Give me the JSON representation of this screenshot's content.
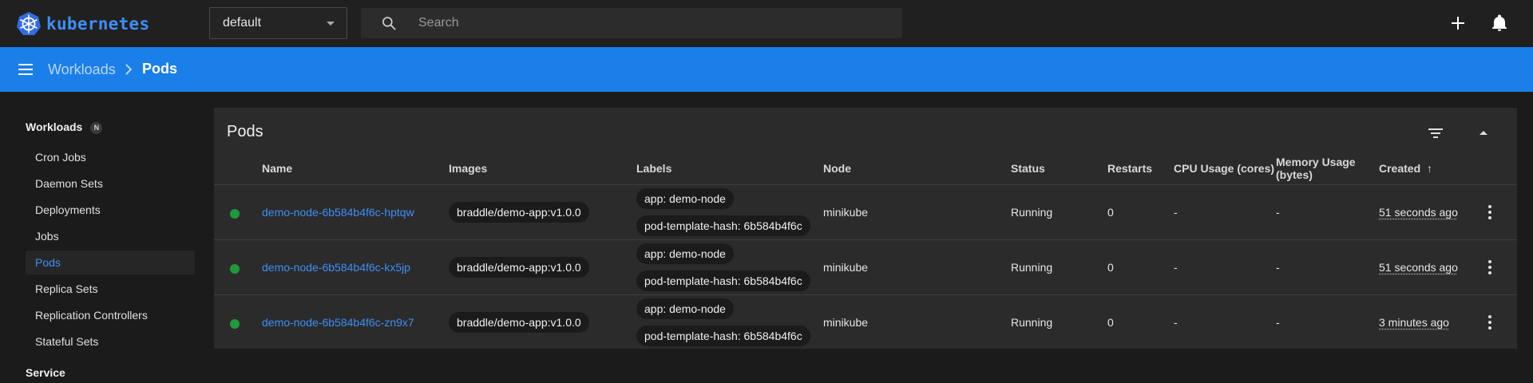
{
  "app": {
    "name": "kubernetes",
    "brand_color": "#326ce5",
    "accent_color": "#1a7fe8",
    "link_color": "#3d8ff5"
  },
  "topbar": {
    "namespace": "default",
    "search_placeholder": "Search",
    "icons": [
      "search-icon",
      "plus-icon",
      "bell-icon"
    ]
  },
  "breadcrumb": {
    "parent": "Workloads",
    "current": "Pods"
  },
  "sidebar": {
    "sections": [
      {
        "title": "Workloads",
        "badge": "N",
        "items": [
          {
            "label": "Cron Jobs",
            "active": false
          },
          {
            "label": "Daemon Sets",
            "active": false
          },
          {
            "label": "Deployments",
            "active": false
          },
          {
            "label": "Jobs",
            "active": false
          },
          {
            "label": "Pods",
            "active": true
          },
          {
            "label": "Replica Sets",
            "active": false
          },
          {
            "label": "Replication Controllers",
            "active": false
          },
          {
            "label": "Stateful Sets",
            "active": false
          }
        ]
      },
      {
        "title": "Service"
      }
    ]
  },
  "card": {
    "title": "Pods",
    "columns": {
      "name": "Name",
      "images": "Images",
      "labels": "Labels",
      "node": "Node",
      "status": "Status",
      "restarts": "Restarts",
      "cpu": "CPU Usage (cores)",
      "memory_line1": "Memory Usage",
      "memory_line2": "(bytes)",
      "created": "Created",
      "created_sort": "↑"
    },
    "rows": [
      {
        "name": "demo-node-6b584b4f6c-hptqw",
        "image": "braddle/demo-app:v1.0.0",
        "labels": [
          "app: demo-node",
          "pod-template-hash: 6b584b4f6c"
        ],
        "node": "minikube",
        "status": "Running",
        "restarts": "0",
        "cpu": "-",
        "memory": "-",
        "created": "51 seconds ago"
      },
      {
        "name": "demo-node-6b584b4f6c-kx5jp",
        "image": "braddle/demo-app:v1.0.0",
        "labels": [
          "app: demo-node",
          "pod-template-hash: 6b584b4f6c"
        ],
        "node": "minikube",
        "status": "Running",
        "restarts": "0",
        "cpu": "-",
        "memory": "-",
        "created": "51 seconds ago"
      },
      {
        "name": "demo-node-6b584b4f6c-zn9x7",
        "image": "braddle/demo-app:v1.0.0",
        "labels": [
          "app: demo-node",
          "pod-template-hash: 6b584b4f6c"
        ],
        "node": "minikube",
        "status": "Running",
        "restarts": "0",
        "cpu": "-",
        "memory": "-",
        "created": "3 minutes ago"
      }
    ]
  }
}
